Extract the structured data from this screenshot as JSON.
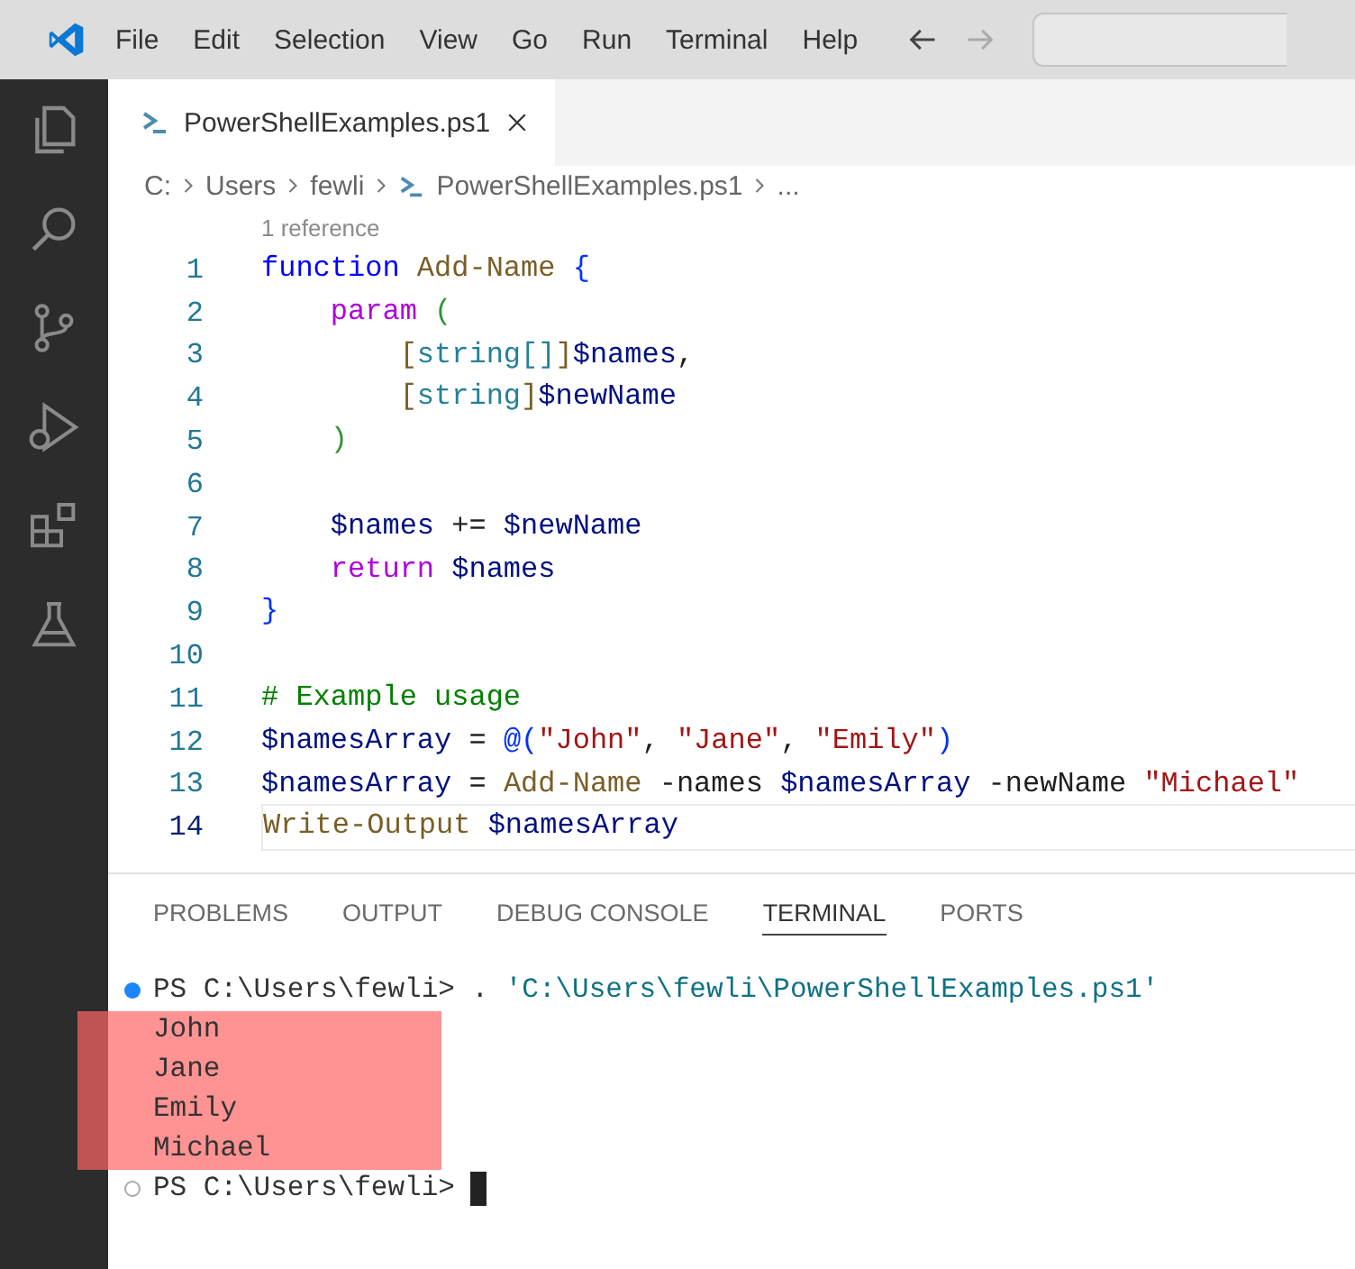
{
  "menu": [
    "File",
    "Edit",
    "Selection",
    "View",
    "Go",
    "Run",
    "Terminal",
    "Help"
  ],
  "activity_bar": [
    {
      "kind": "files"
    },
    {
      "kind": "search"
    },
    {
      "kind": "source-control"
    },
    {
      "kind": "run-debug"
    },
    {
      "kind": "extensions"
    },
    {
      "kind": "testing"
    }
  ],
  "tabs": [
    {
      "label": "PowerShellExamples.ps1",
      "selected": true
    }
  ],
  "breadcrumb": [
    "C:",
    "Users",
    "fewli",
    "PowerShellExamples.ps1",
    "..."
  ],
  "codelens": "1 reference",
  "code_lines": [
    {
      "number": "1",
      "current": false,
      "text": "function Add-Name {"
    },
    {
      "number": "2",
      "current": false,
      "text": "    param ("
    },
    {
      "number": "3",
      "current": false,
      "text": "        [string[]]$names,"
    },
    {
      "number": "4",
      "current": false,
      "text": "        [string]$newName"
    },
    {
      "number": "5",
      "current": false,
      "text": "    )"
    },
    {
      "number": "6",
      "current": false
    },
    {
      "number": "7",
      "current": false,
      "text": "    $names += $newName"
    },
    {
      "number": "8",
      "current": false,
      "text": "    return $names"
    },
    {
      "number": "9",
      "current": false,
      "text": "}"
    },
    {
      "number": "10",
      "current": false
    },
    {
      "number": "11",
      "current": false,
      "text": "# Example usage"
    },
    {
      "number": "12",
      "current": false,
      "text": "$namesArray = @(\"John\", \"Jane\", \"Emily\")"
    },
    {
      "number": "13",
      "current": false,
      "text": "$namesArray = Add-Name -names $namesArray -newName \"Michael\""
    },
    {
      "number": "14",
      "current": true,
      "text": "Write-Output $namesArray"
    }
  ],
  "panel_tabs": [
    {
      "label": "PROBLEMS",
      "selected": false
    },
    {
      "label": "OUTPUT",
      "selected": false
    },
    {
      "label": "DEBUG CONSOLE",
      "selected": false
    },
    {
      "label": "TERMINAL",
      "selected": true
    },
    {
      "label": "PORTS",
      "selected": false
    }
  ],
  "terminal": {
    "command_line": {
      "completed": true,
      "prompt": "PS C:\\Users\\fewli>",
      "command": ".",
      "argument": "'C:\\Users\\fewli\\PowerShellExamples.ps1'"
    },
    "output": [
      "John",
      "Jane",
      "Emily",
      "Michael"
    ],
    "output_highlighted": true,
    "prompt_line": {
      "completed": false,
      "prompt": "PS C:\\Users\\fewli>"
    }
  }
}
